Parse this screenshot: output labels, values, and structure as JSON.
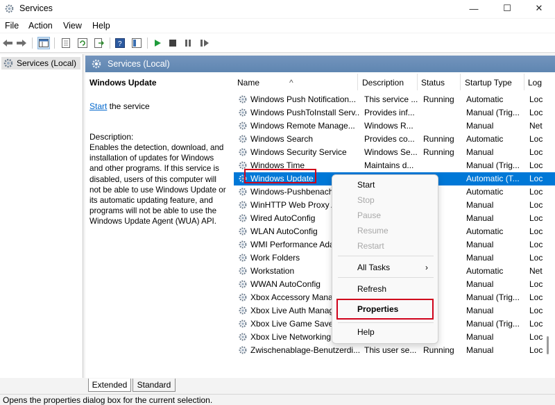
{
  "window": {
    "title": "Services",
    "minimize": "—",
    "maximize": "☐",
    "close": "✕"
  },
  "menu": [
    "File",
    "Action",
    "View",
    "Help"
  ],
  "tree": {
    "item": "Services (Local)"
  },
  "panel": {
    "header": "Services (Local)"
  },
  "description": {
    "service_name": "Windows Update",
    "start_link": "Start",
    "start_suffix": " the service",
    "label": "Description:",
    "text": "Enables the detection, download, and installation of updates for Windows and other programs. If this service is disabled, users of this computer will not be able to use Windows Update or its automatic updating feature, and programs will not be able to use the Windows Update Agent (WUA) API."
  },
  "columns": {
    "name": "Name",
    "description": "Description",
    "status": "Status",
    "startup": "Startup Type",
    "log": "Log"
  },
  "rows": [
    {
      "name": "Windows Push Notification...",
      "desc": "This service ...",
      "status": "Running",
      "startup": "Automatic",
      "log": "Loc"
    },
    {
      "name": "Windows PushToInstall Serv...",
      "desc": "Provides inf...",
      "status": "",
      "startup": "Manual (Trig...",
      "log": "Loc"
    },
    {
      "name": "Windows Remote Manage...",
      "desc": "Windows R...",
      "status": "",
      "startup": "Manual",
      "log": "Net"
    },
    {
      "name": "Windows Search",
      "desc": "Provides co...",
      "status": "Running",
      "startup": "Automatic",
      "log": "Loc"
    },
    {
      "name": "Windows Security Service",
      "desc": "Windows Se...",
      "status": "Running",
      "startup": "Manual",
      "log": "Loc"
    },
    {
      "name": "Windows Time",
      "desc": "Maintains d...",
      "status": "",
      "startup": "Manual (Trig...",
      "log": "Loc"
    },
    {
      "name": "Windows Update",
      "desc": "",
      "status": "",
      "startup": "Automatic (T...",
      "log": "Loc"
    },
    {
      "name": "Windows-Pushbenach",
      "desc": "",
      "status": "ning",
      "startup": "Automatic",
      "log": "Loc"
    },
    {
      "name": "WinHTTP Web Proxy A",
      "desc": "",
      "status": "ning",
      "startup": "Manual",
      "log": "Loc"
    },
    {
      "name": "Wired AutoConfig",
      "desc": "",
      "status": "",
      "startup": "Manual",
      "log": "Loc"
    },
    {
      "name": "WLAN AutoConfig",
      "desc": "",
      "status": "ning",
      "startup": "Automatic",
      "log": "Loc"
    },
    {
      "name": "WMI Performance Ada",
      "desc": "",
      "status": "ning",
      "startup": "Manual",
      "log": "Loc"
    },
    {
      "name": "Work Folders",
      "desc": "",
      "status": "",
      "startup": "Manual",
      "log": "Loc"
    },
    {
      "name": "Workstation",
      "desc": "",
      "status": "ning",
      "startup": "Automatic",
      "log": "Net"
    },
    {
      "name": "WWAN AutoConfig",
      "desc": "",
      "status": "",
      "startup": "Manual",
      "log": "Loc"
    },
    {
      "name": "Xbox Accessory Manag",
      "desc": "",
      "status": "",
      "startup": "Manual (Trig...",
      "log": "Loc"
    },
    {
      "name": "Xbox Live Auth Manag",
      "desc": "",
      "status": "",
      "startup": "Manual",
      "log": "Loc"
    },
    {
      "name": "Xbox Live Game Save",
      "desc": "",
      "status": "",
      "startup": "Manual (Trig...",
      "log": "Loc"
    },
    {
      "name": "Xbox Live Networking",
      "desc": "",
      "status": "",
      "startup": "Manual",
      "log": "Loc"
    },
    {
      "name": "Zwischenablage-Benutzerdi...",
      "desc": "This user se...",
      "status": "Running",
      "startup": "Manual",
      "log": "Loc"
    }
  ],
  "context_menu": {
    "start": "Start",
    "stop": "Stop",
    "pause": "Pause",
    "resume": "Resume",
    "restart": "Restart",
    "all_tasks": "All Tasks",
    "refresh": "Refresh",
    "properties": "Properties",
    "help": "Help"
  },
  "tabs": {
    "extended": "Extended",
    "standard": "Standard"
  },
  "status": "Opens the properties dialog box for the current selection.",
  "colors": {
    "selection": "#0078d7",
    "highlight": "#d0021b",
    "header": "#6a8fb6"
  }
}
